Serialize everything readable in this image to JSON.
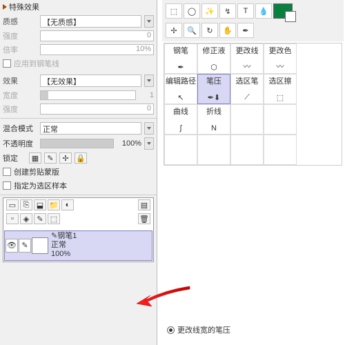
{
  "fx": {
    "header": "特殊效果",
    "texture_lbl": "质感",
    "texture_val": "【无质感】",
    "intensity_lbl": "强度",
    "intensity_val": "0",
    "rate_lbl": "倍率",
    "rate_val": "10%",
    "apply_pen": "应用到钢笔线",
    "effect_lbl": "效果",
    "effect_val": "【无效果】",
    "width_lbl": "宽度",
    "width_val": "1",
    "intensity2_lbl": "强度",
    "intensity2_val": "0"
  },
  "blend": {
    "mode_lbl": "混合模式",
    "mode_val": "正常",
    "opacity_lbl": "不透明度",
    "opacity_val": "100%",
    "lock_lbl": "锁定"
  },
  "masks": {
    "create_clip": "创建剪贴蒙版",
    "set_sel": "指定为选区样本"
  },
  "layer": {
    "name": "钢笔1",
    "mode": "正常",
    "opacity": "100%"
  },
  "grid": {
    "r1": [
      "钢笔",
      "修正液",
      "更改线",
      "更改色"
    ],
    "r2": [
      "编辑路径",
      "笔压",
      "选区笔",
      "选区擦"
    ],
    "r3": [
      "曲线",
      "折线",
      "",
      ""
    ]
  },
  "icons": {
    "r1": [
      "✒",
      "⬡",
      "〰",
      "〰"
    ],
    "r2": [
      "↖",
      "✒⬇",
      "⟋",
      "⬚"
    ],
    "r3": [
      "∫",
      "N",
      "",
      ""
    ]
  },
  "radio": "更改线宽的笔压"
}
